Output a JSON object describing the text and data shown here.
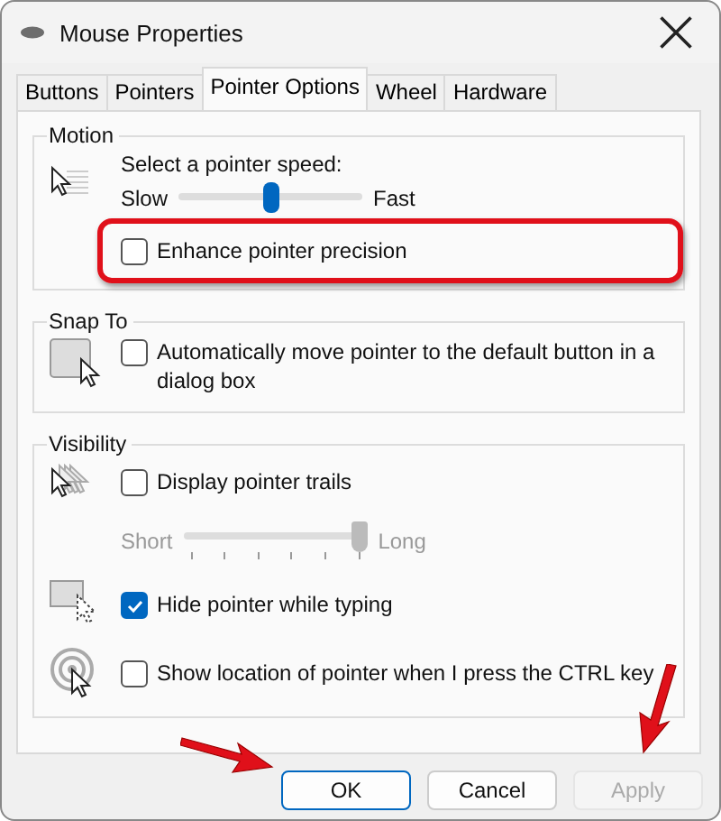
{
  "window": {
    "title": "Mouse Properties"
  },
  "tabs": [
    {
      "label": "Buttons",
      "selected": false
    },
    {
      "label": "Pointers",
      "selected": false
    },
    {
      "label": "Pointer Options",
      "selected": true
    },
    {
      "label": "Wheel",
      "selected": false
    },
    {
      "label": "Hardware",
      "selected": false
    }
  ],
  "groups": [
    {
      "title": "Motion",
      "rows": [
        {
          "kind": "slider",
          "label": "Select a pointer speed:",
          "min_label": "Slow",
          "max_label": "Fast",
          "level": 0.5,
          "disabled": false
        },
        {
          "kind": "checkbox",
          "label": "Enhance pointer precision",
          "checked": false,
          "highlighted": true
        }
      ]
    },
    {
      "title": "Snap To",
      "rows": [
        {
          "kind": "checkbox",
          "label": "Automatically move pointer to the default button in a dialog box",
          "checked": false,
          "highlighted": false
        }
      ]
    },
    {
      "title": "Visibility",
      "rows": [
        {
          "kind": "checkbox",
          "label": "Display pointer trails",
          "checked": false,
          "highlighted": false
        },
        {
          "kind": "slider",
          "min_label": "Short",
          "max_label": "Long",
          "level": 1,
          "disabled": true
        },
        {
          "kind": "checkbox",
          "label": "Hide pointer while typing",
          "checked": true,
          "highlighted": false
        },
        {
          "kind": "checkbox",
          "label": "Show location of pointer when I press the CTRL key",
          "checked": false,
          "highlighted": false
        }
      ]
    }
  ],
  "buttons": [
    {
      "label": "OK",
      "default": true,
      "disabled": false
    },
    {
      "label": "Cancel",
      "default": false,
      "disabled": false
    },
    {
      "label": "Apply",
      "default": false,
      "disabled": true
    }
  ]
}
